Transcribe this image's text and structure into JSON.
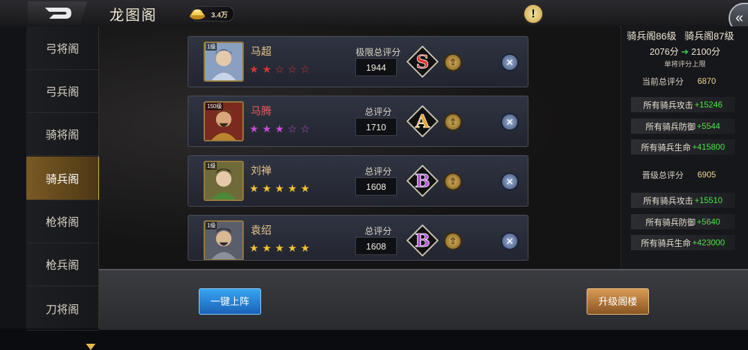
{
  "header": {
    "title": "龙图阁",
    "currency_amount": "3.4万"
  },
  "sidebar": {
    "items": [
      {
        "label": "弓将阁",
        "active": false
      },
      {
        "label": "弓兵阁",
        "active": false
      },
      {
        "label": "骑将阁",
        "active": false
      },
      {
        "label": "骑兵阁",
        "active": true
      },
      {
        "label": "枪将阁",
        "active": false
      },
      {
        "label": "枪兵阁",
        "active": false
      },
      {
        "label": "刀将阁",
        "active": false
      }
    ]
  },
  "heroes": [
    {
      "level": "1级",
      "name": "马超",
      "name_color": "#e9c58a",
      "stars_filled": 2,
      "stars_total": 5,
      "star_color": "#d93434",
      "score_label": "极限总评分",
      "score": "1944",
      "grade": "S",
      "grade_color": "#e0342c"
    },
    {
      "level": "150级",
      "name": "马腾",
      "name_color": "#ea5a5a",
      "stars_filled": 3,
      "stars_total": 5,
      "star_color": "#c94ad6",
      "score_label": "总评分",
      "score": "1710",
      "grade": "A",
      "grade_color": "#e7a429"
    },
    {
      "level": "1级",
      "name": "刘禅",
      "name_color": "#e9c58a",
      "stars_filled": 5,
      "stars_total": 5,
      "star_color": "#f2c230",
      "score_label": "总评分",
      "score": "1608",
      "grade": "B",
      "grade_color": "#b45ad8"
    },
    {
      "level": "1级",
      "name": "袁绍",
      "name_color": "#e9c58a",
      "stars_filled": 5,
      "stars_total": 5,
      "star_color": "#f2c230",
      "score_label": "总评分",
      "score": "1608",
      "grade": "B",
      "grade_color": "#b45ad8"
    }
  ],
  "right_panel": {
    "current_level": "骑兵阁86级",
    "next_level": "骑兵阁87级",
    "score_from": "2076分",
    "score_to": "2100分",
    "cap_note": "单将评分上限",
    "current_total_label": "当前总评分",
    "current_total": "6870",
    "current_bonuses": [
      {
        "label": "所有骑兵攻击",
        "value": "+15246"
      },
      {
        "label": "所有骑兵防御",
        "value": "+5544"
      },
      {
        "label": "所有骑兵生命",
        "value": "+415800"
      }
    ],
    "next_total_label": "晋级总评分",
    "next_total": "6905",
    "next_bonuses": [
      {
        "label": "所有骑兵攻击",
        "value": "+15510"
      },
      {
        "label": "所有骑兵防御",
        "value": "+5640"
      },
      {
        "label": "所有骑兵生命",
        "value": "+423000"
      }
    ]
  },
  "buttons": {
    "deploy": "一键上阵",
    "upgrade": "升级阁楼"
  },
  "colors": {
    "accent_gold": "#e9b64a",
    "bonus_green": "#4ee34a",
    "score_gold": "#f1d68b"
  },
  "icons": [
    "back-icon",
    "gold-ingot-icon",
    "alert-icon",
    "collapse-icon",
    "upgrade-arrow-icon",
    "remove-x-icon",
    "scroll-down-icon"
  ]
}
